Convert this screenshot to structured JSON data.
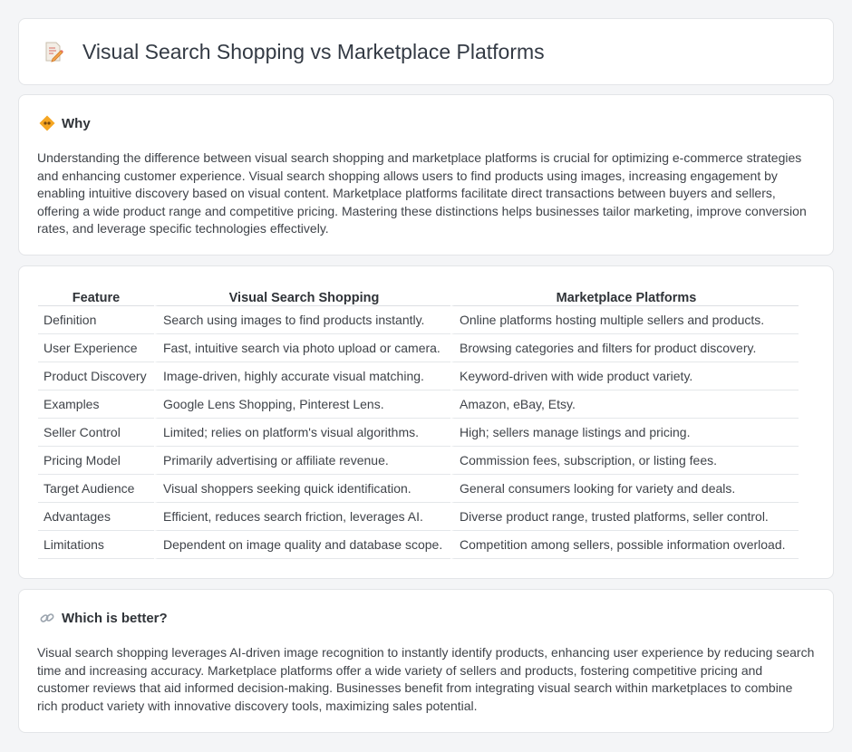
{
  "header": {
    "title": "Visual Search Shopping vs Marketplace Platforms",
    "icon": "document-pencil-icon"
  },
  "why": {
    "title": "Why",
    "icon": "diamond-sign-icon",
    "body": "Understanding the difference between visual search shopping and marketplace platforms is crucial for optimizing e-commerce strategies and enhancing customer experience. Visual search shopping allows users to find products using images, increasing engagement by enabling intuitive discovery based on visual content. Marketplace platforms facilitate direct transactions between buyers and sellers, offering a wide product range and competitive pricing. Mastering these distinctions helps businesses tailor marketing, improve conversion rates, and leverage specific technologies effectively."
  },
  "comparison": {
    "headers": [
      "Feature",
      "Visual Search Shopping",
      "Marketplace Platforms"
    ],
    "rows": [
      [
        "Definition",
        "Search using images to find products instantly.",
        "Online platforms hosting multiple sellers and products."
      ],
      [
        "User Experience",
        "Fast, intuitive search via photo upload or camera.",
        "Browsing categories and filters for product discovery."
      ],
      [
        "Product Discovery",
        "Image-driven, highly accurate visual matching.",
        "Keyword-driven with wide product variety."
      ],
      [
        "Examples",
        "Google Lens Shopping, Pinterest Lens.",
        "Amazon, eBay, Etsy."
      ],
      [
        "Seller Control",
        "Limited; relies on platform's visual algorithms.",
        "High; sellers manage listings and pricing."
      ],
      [
        "Pricing Model",
        "Primarily advertising or affiliate revenue.",
        "Commission fees, subscription, or listing fees."
      ],
      [
        "Target Audience",
        "Visual shoppers seeking quick identification.",
        "General consumers looking for variety and deals."
      ],
      [
        "Advantages",
        "Efficient, reduces search friction, leverages AI.",
        "Diverse product range, trusted platforms, seller control."
      ],
      [
        "Limitations",
        "Dependent on image quality and database scope.",
        "Competition among sellers, possible information overload."
      ]
    ]
  },
  "better": {
    "title": "Which is better?",
    "icon": "link-icon",
    "body": "Visual search shopping leverages AI-driven image recognition to instantly identify products, enhancing user experience by reducing search time and increasing accuracy. Marketplace platforms offer a wide variety of sellers and products, fostering competitive pricing and customer reviews that aid informed decision-making. Businesses benefit from integrating visual search within marketplaces to combine rich product variety with innovative discovery tools, maximizing sales potential."
  }
}
